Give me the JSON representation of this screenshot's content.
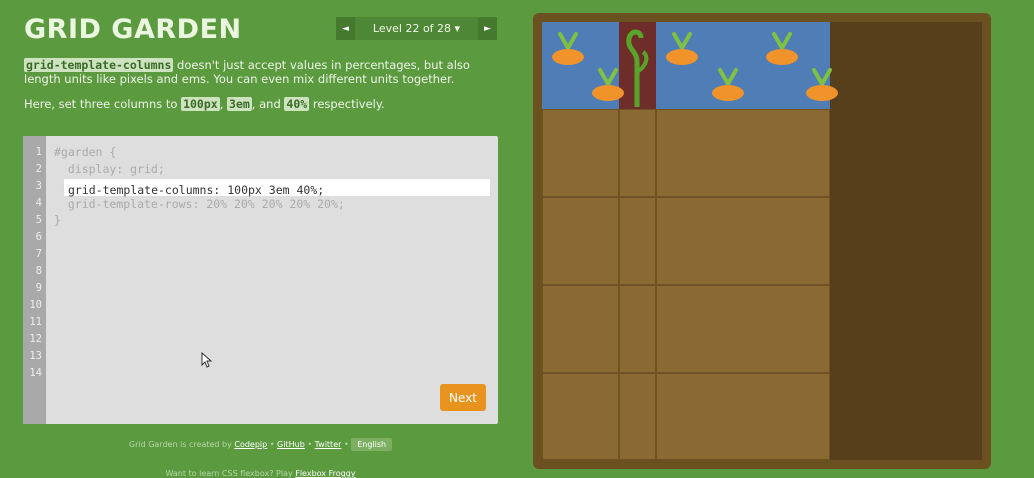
{
  "app": {
    "title": "GRID GARDEN"
  },
  "level_nav": {
    "prev_icon": "◄",
    "next_icon": "►",
    "label": "Level 22 of 28 ▾"
  },
  "description": {
    "p1_code": "grid-template-columns",
    "p1_text": " doesn't just accept values in percentages, but also length units like pixels and ems. You can even mix different units together.",
    "p2_pre": "Here, set three columns to ",
    "p2_code1": "100px",
    "p2_sep1": ", ",
    "p2_code2": "3em",
    "p2_sep2": ", and ",
    "p2_code3": "40%",
    "p2_post": " respectively."
  },
  "editor": {
    "line_numbers": [
      "1",
      "2",
      "3",
      "4",
      "5",
      "6",
      "7",
      "8",
      "9",
      "10",
      "11",
      "12",
      "13",
      "14"
    ],
    "line1": "#garden {",
    "line2": "  display: grid;",
    "line4": "  grid-template-rows: 20% 20% 20% 20% 20%;",
    "line5": "}",
    "input_value": "grid-template-columns: 100px 3em 40%;",
    "next_label": "Next"
  },
  "footer": {
    "credit_pre": "Grid Garden is created by ",
    "codepip": "Codepip",
    "sep1": " • ",
    "github": "GitHub",
    "sep2": " • ",
    "twitter": "Twitter",
    "sep3": " • ",
    "language": "English",
    "flexbox_pre": "Want to learn CSS flexbox? Play ",
    "flexbox_link": "Flexbox Froggy"
  },
  "colors": {
    "background": "#5b9a3f",
    "water": "#4f7db5",
    "dirt": "#8a6a32",
    "next_button": "#e8931d"
  }
}
